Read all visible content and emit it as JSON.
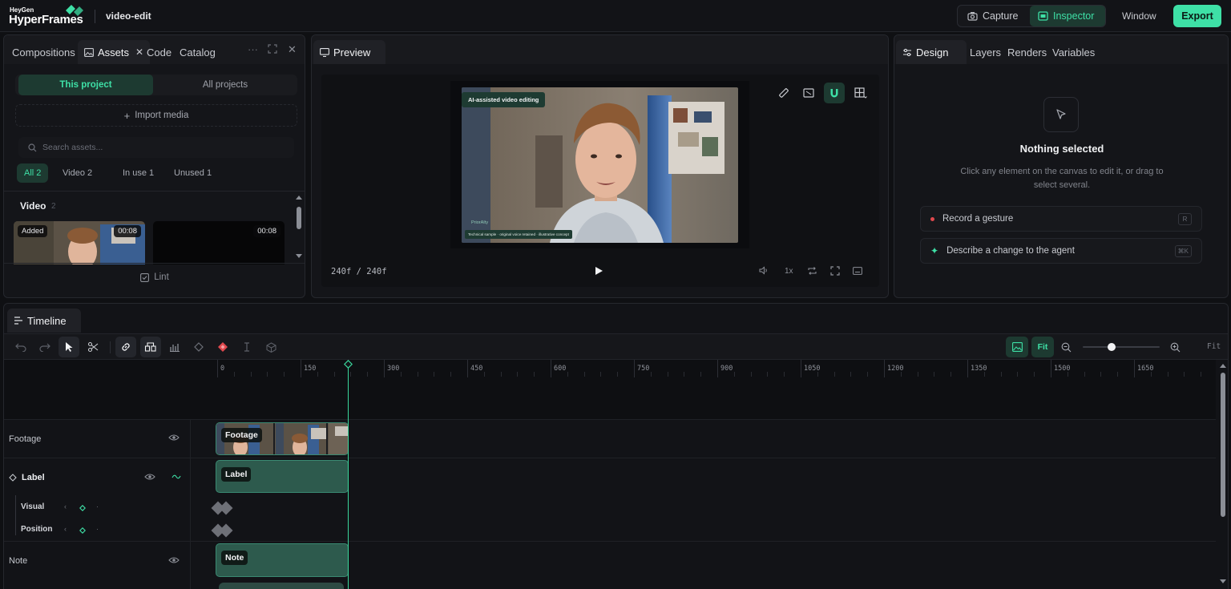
{
  "app": {
    "logo_top": "HeyGen",
    "logo_main": "HyperFrames",
    "project": "video-edit"
  },
  "topbar": {
    "capture_label": "Capture",
    "inspector_label": "Inspector",
    "window_label": "Window",
    "export_label": "Export",
    "accent": "#3ee0a6"
  },
  "assets_panel": {
    "tabs": [
      "Compositions",
      "Assets",
      "Code",
      "Catalog"
    ],
    "active_tab": "Assets",
    "scope": {
      "this_project": "This project",
      "all_projects": "All projects"
    },
    "import_label": "Import media",
    "search_placeholder": "Search assets...",
    "filters": [
      {
        "label": "All 2",
        "active": true
      },
      {
        "label": "Video 2",
        "active": false
      },
      {
        "label": "In use 1",
        "active": false
      },
      {
        "label": "Unused 1",
        "active": false
      }
    ],
    "section_title": "Video",
    "section_count": "2",
    "items": [
      {
        "badge": "Added",
        "duration": "00:08"
      },
      {
        "badge": "",
        "duration": "00:08"
      }
    ],
    "lint_label": "Lint"
  },
  "preview": {
    "tab_label": "Preview",
    "overlay_title": "AI-assisted video editing",
    "overlay_caption": "Technical sample · original voice retained · illustrative concept",
    "watermark": "PriorAIty",
    "frame_counter": "240f / 240f",
    "speed": "1x"
  },
  "inspector": {
    "tabs": [
      "Design",
      "Layers",
      "Renders",
      "Variables"
    ],
    "active_tab": "Design",
    "empty_title": "Nothing selected",
    "empty_desc": "Click any element on the canvas to edit it, or drag to select several.",
    "actions": [
      {
        "label": "Record a gesture",
        "shortcut": "R",
        "icon": "record-dot-icon"
      },
      {
        "label": "Describe a change to the agent",
        "shortcut": "⌘K",
        "icon": "sparkle-icon"
      }
    ]
  },
  "timeline": {
    "tab_label": "Timeline",
    "fit_label": "Fit",
    "zoom_fit_label": "Fit",
    "zoom_level": 0.37,
    "ruler_labels": [
      "0",
      "150",
      "300",
      "450",
      "600",
      "750",
      "900",
      "1050",
      "1200",
      "1350",
      "1500",
      "1650"
    ],
    "tracks": [
      {
        "name": "Footage",
        "clip": "Footage"
      },
      {
        "name": "Label",
        "clip": "Label",
        "props": [
          "Visual",
          "Position"
        ]
      },
      {
        "name": "Note",
        "clip": "Note"
      }
    ],
    "playhead_frame": 240
  }
}
